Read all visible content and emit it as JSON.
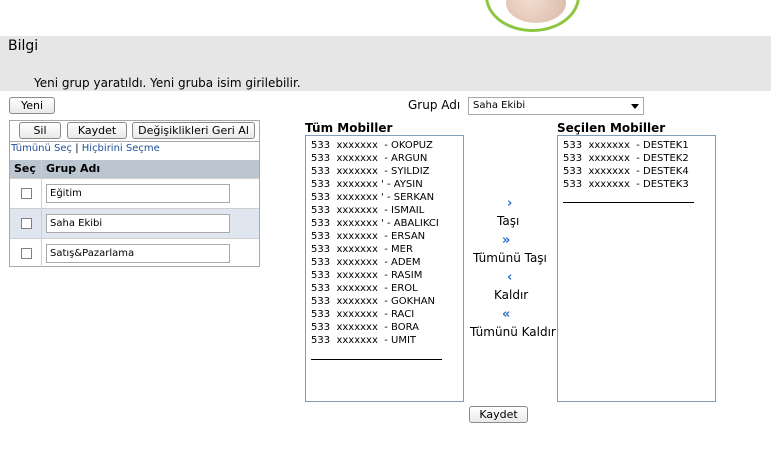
{
  "header": {
    "section_title": "Bilgi",
    "message": "Yeni grup yaratıldı. Yeni gruba isim girilebilir."
  },
  "toolbar": {
    "new_label": "Yeni",
    "delete_label": "Sil",
    "save_label": "Kaydet",
    "revert_label": "Değişiklikleri Geri Al",
    "select_all": "Tümünü Seç",
    "separator": "|",
    "select_none": "Hiçbirini Seçme"
  },
  "group_table": {
    "col_select": "Seç",
    "col_name": "Grup Adı",
    "rows": [
      {
        "name": "Eğitim",
        "selected": false
      },
      {
        "name": "Saha Ekibi",
        "selected": true
      },
      {
        "name": "Satış&Pazarlama",
        "selected": false
      }
    ]
  },
  "group_select": {
    "label": "Grup Adı",
    "value": "Saha Ekibi"
  },
  "all_mobiles": {
    "title": "Tüm Mobiller",
    "items": [
      "533  xxxxxxx  - OKOPUZ",
      "533  xxxxxxx  - ARGUN",
      "533  xxxxxxx  - SYILDIZ",
      "533  xxxxxxx ' - AYSIN",
      "533  xxxxxxx ' - SERKAN",
      "533  xxxxxxx  - ISMAIL",
      "533  xxxxxxx ' - ABALIKCI",
      "533  xxxxxxx  - ERSAN",
      "533  xxxxxxx  - MER",
      "533  xxxxxxx  - ADEM",
      "533  xxxxxxx  - RASIM",
      "533  xxxxxxx  - EROL",
      "533  xxxxxxx  - GOKHAN",
      "533  xxxxxxx  - RACI",
      "533  xxxxxxx  - BORA",
      "533  xxxxxxx  - UMIT"
    ]
  },
  "selected_mobiles": {
    "title": "Seçilen Mobiller",
    "items": [
      "533  xxxxxxx  - DESTEK1",
      "533  xxxxxxx  - DESTEK2",
      "533  xxxxxxx  - DESTEK4",
      "533  xxxxxxx  - DESTEK3"
    ]
  },
  "actions": {
    "move": "Taşı",
    "move_all": "Tümünü Taşı",
    "remove": "Kaldır",
    "remove_all": "Tümünü Kaldır",
    "arrow_right": "›",
    "arrow_right_double": "»",
    "arrow_left": "‹",
    "arrow_left_double": "«"
  },
  "footer": {
    "save_label": "Kaydet"
  },
  "colors": {
    "accent": "#2a6fc9",
    "banner": "#e6e6e6",
    "table_header": "#bcc6d1",
    "selected_row": "#dfe6f0",
    "logo_ring": "#8cc63f"
  }
}
